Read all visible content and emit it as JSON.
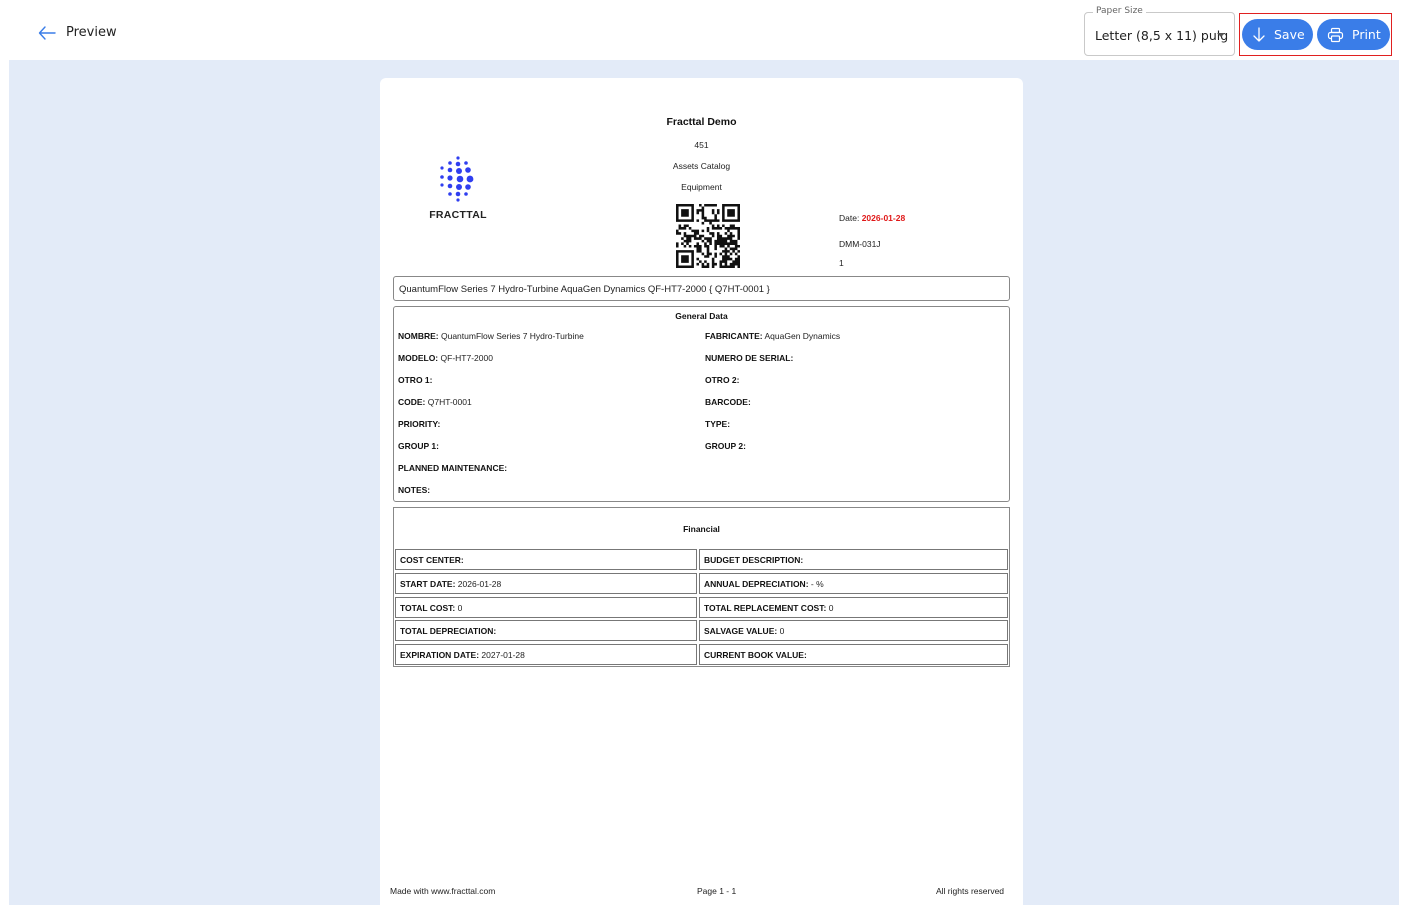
{
  "header": {
    "title": "Preview",
    "paper_size": {
      "legend": "Paper Size",
      "value": "Letter (8,5 x 11) pulg"
    },
    "save_label": "Save",
    "print_label": "Print"
  },
  "colors": {
    "accent": "#3a7de8",
    "workspace_bg": "#e3ebf8",
    "highlight": "#e02020",
    "date_red": "#e01818",
    "logo_blue": "#2f3ef0"
  },
  "document": {
    "company": "Fracttal Demo",
    "id": "451",
    "catalog": "Assets Catalog",
    "category": "Equipment",
    "logo_text": "FRACTTAL",
    "date_label": "Date:",
    "date_value": "2026-01-28",
    "doc_code": "DMM-031J",
    "doc_version": "1",
    "asset_title": "QuantumFlow Series 7 Hydro-Turbine AquaGen Dynamics QF-HT7-2000 { Q7HT-0001 }",
    "general": {
      "title": "General Data",
      "nombre_label": "NOMBRE:",
      "nombre_value": "QuantumFlow Series 7 Hydro-Turbine",
      "fabricante_label": "FABRICANTE:",
      "fabricante_value": "AquaGen Dynamics",
      "modelo_label": "MODELO:",
      "modelo_value": "QF-HT7-2000",
      "serial_label": "NUMERO DE SERIAL:",
      "otro1_label": "OTRO 1:",
      "otro2_label": "OTRO 2:",
      "code_label": "CODE:",
      "code_value": "Q7HT-0001",
      "barcode_label": "BARCODE:",
      "priority_label": "PRIORITY:",
      "type_label": "TYPE:",
      "group1_label": "GROUP 1:",
      "group2_label": "GROUP 2:",
      "planned_label": "PLANNED MAINTENANCE:",
      "notes_label": "NOTES:"
    },
    "financial": {
      "title": "Financial",
      "cost_center_label": "COST CENTER:",
      "budget_label": "BUDGET DESCRIPTION:",
      "start_label": "START DATE:",
      "start_value": "2026-01-28",
      "annual_dep_label": "ANNUAL DEPRECIATION:",
      "annual_dep_value": "- %",
      "total_cost_label": "TOTAL COST:",
      "total_cost_value": "0",
      "replacement_label": "TOTAL REPLACEMENT COST:",
      "replacement_value": "0",
      "total_dep_label": "TOTAL DEPRECIATION:",
      "salvage_label": "SALVAGE VALUE:",
      "salvage_value": "0",
      "expiration_label": "EXPIRATION DATE:",
      "expiration_value": "2027-01-28",
      "book_value_label": "CURRENT BOOK VALUE:"
    },
    "footer": {
      "left": "Made with www.fracttal.com",
      "center": "Page 1 - 1",
      "right": "All rights reserved"
    }
  }
}
